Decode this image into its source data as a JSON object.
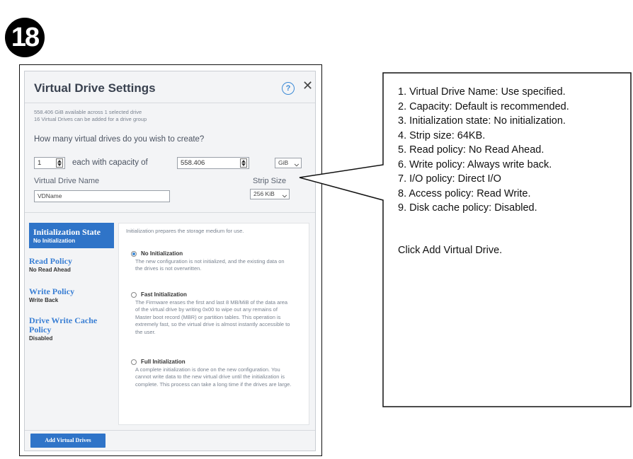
{
  "step_number": "18",
  "dialog": {
    "title": "Virtual Drive Settings",
    "help_glyph": "?",
    "close_glyph": "✕",
    "info_lines": [
      "558.406 GiB available across 1 selected drive",
      "16 Virtual Drives can be added for a drive group"
    ],
    "question": "How many virtual drives do you wish to create?",
    "count_value": "1",
    "each_label": "each with capacity of",
    "capacity_value": "558.406",
    "unit_value": "GiB",
    "name_label": "Virtual Drive Name",
    "name_value": "VDName",
    "strip_label": "Strip Size",
    "strip_value": "256 KiB",
    "nav": [
      {
        "title": "Initialization State",
        "sub": "No Initialization"
      },
      {
        "title": "Read Policy",
        "sub": "No Read Ahead"
      },
      {
        "title": "Write Policy",
        "sub": "Write Back"
      },
      {
        "title": "Drive Write Cache Policy",
        "sub": "Disabled"
      }
    ],
    "panel_desc": "Initialization prepares the storage medium for use.",
    "options": [
      {
        "title": "No Initialization",
        "desc": "The new configuration is not initialized, and the existing data on the drives is not overwritten.",
        "selected": true
      },
      {
        "title": "Fast Initialization",
        "desc": "The Firmware erases the first and last 8 MB/MiB of the data area of the virtual drive by writing 0x00 to wipe out any remains of Master boot record (MBR) or partition tables. This operation is extremely fast, so the virtual drive is almost instantly accessible to the user.",
        "selected": false
      },
      {
        "title": "Full Initialization",
        "desc": "A complete initialization is done on the new configuration. You cannot write data to the new virtual drive until the initialization is complete. This process can take a long time if the drives are large.",
        "selected": false
      }
    ],
    "add_button": "Add Virtual Drives"
  },
  "callout": {
    "items": [
      "1. Virtual Drive Name:  Use specified.",
      "2. Capacity: Default is recommended.",
      "3. Initialization state: No initialization.",
      "4. Strip size: 64KB.",
      "5. Read policy: No Read Ahead.",
      "6. Write policy: Always write back.",
      "7. I/O policy: Direct I/O",
      "8. Access policy: Read Write.",
      "9. Disk cache policy: Disabled."
    ],
    "footer": "Click Add Virtual Drive."
  }
}
